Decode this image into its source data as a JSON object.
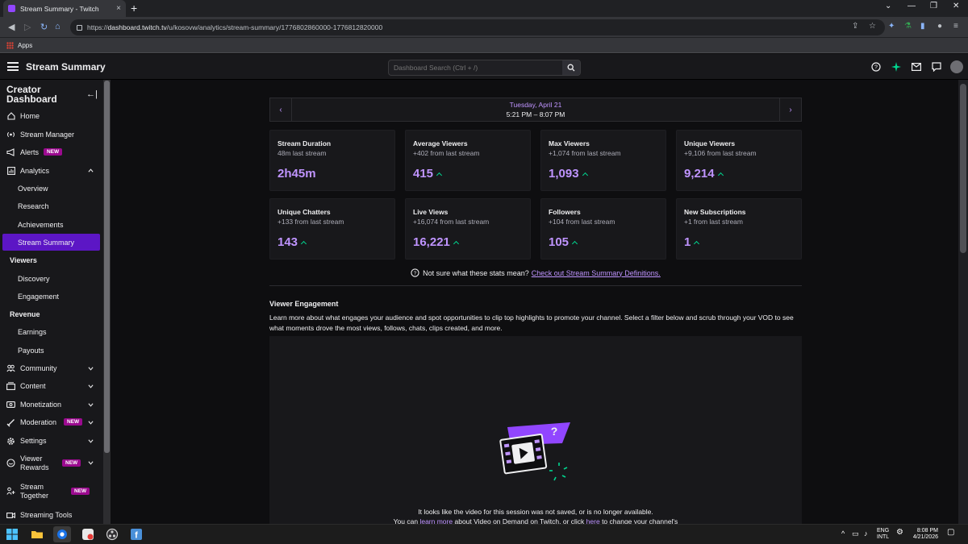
{
  "browser": {
    "tab_title": "Stream Summary - Twitch",
    "tab_close": "×",
    "new_tab": "+",
    "window_controls": [
      "⌄",
      "—",
      "❐",
      "✕"
    ],
    "url_scheme": "https://",
    "url_host": "dashboard.twitch.tv",
    "url_path": "/u/kosovw/analytics/stream-summary/1776802860000-1776812820000",
    "bookmark_apps": "Apps"
  },
  "header": {
    "title": "Stream Summary",
    "search_placeholder": "Dashboard Search (Ctrl + /)"
  },
  "sidebar": {
    "title_line1": "Creator",
    "title_line2": "Dashboard",
    "collapse_glyph": "←|",
    "items": [
      {
        "label": "Home"
      },
      {
        "label": "Stream Manager"
      },
      {
        "label": "Alerts",
        "badge": "NEW"
      },
      {
        "label": "Analytics"
      },
      {
        "label": "Overview"
      },
      {
        "label": "Research"
      },
      {
        "label": "Achievements"
      },
      {
        "label": "Stream Summary"
      },
      {
        "label": "Viewers"
      },
      {
        "label": "Discovery"
      },
      {
        "label": "Engagement"
      },
      {
        "label": "Revenue"
      },
      {
        "label": "Earnings"
      },
      {
        "label": "Payouts"
      },
      {
        "label": "Community"
      },
      {
        "label": "Content"
      },
      {
        "label": "Monetization"
      },
      {
        "label": "Moderation",
        "badge": "NEW"
      },
      {
        "label": "Settings"
      },
      {
        "label": "Viewer",
        "label2": "Rewards",
        "badge": "NEW"
      },
      {
        "label": "Stream",
        "label2": "Together",
        "badge": "NEW"
      },
      {
        "label": "Streaming Tools"
      }
    ]
  },
  "date": {
    "prev": "‹",
    "next": "›",
    "day": "Tuesday, April 21",
    "time": "5:21 PM – 8:07 PM"
  },
  "stats": [
    {
      "title": "Stream Duration",
      "delta": "48m last stream",
      "value": "2h45m",
      "arrow": false
    },
    {
      "title": "Average Viewers",
      "delta": "+402 from last stream",
      "value": "415",
      "arrow": true
    },
    {
      "title": "Max Viewers",
      "delta": "+1,074 from last stream",
      "value": "1,093",
      "arrow": true
    },
    {
      "title": "Unique Viewers",
      "delta": "+9,106 from last stream",
      "value": "9,214",
      "arrow": true
    },
    {
      "title": "Unique Chatters",
      "delta": "+133 from last stream",
      "value": "143",
      "arrow": true
    },
    {
      "title": "Live Views",
      "delta": "+16,074 from last stream",
      "value": "16,221",
      "arrow": true
    },
    {
      "title": "Followers",
      "delta": "+104 from last stream",
      "value": "105",
      "arrow": true
    },
    {
      "title": "New Subscriptions",
      "delta": "+1 from last stream",
      "value": "1",
      "arrow": true
    }
  ],
  "help": {
    "text": "Not sure what these stats mean?",
    "link": "Check out Stream Summary Definitions."
  },
  "engagement": {
    "title": "Viewer Engagement",
    "description": "Learn more about what engages your audience and spot opportunities to clip top highlights to promote your channel. Select a filter below and scrub through your VOD to see what moments drove the most views, follows, chats, clips created, and more.",
    "msg_line1": "It looks like the video for this session was not saved, or is no longer available.",
    "msg_pre": "You can",
    "msg_link1": "learn more",
    "msg_mid": "about Video on Demand on Twitch, or click",
    "msg_link2": "here",
    "msg_post": "to change your channel's"
  },
  "taskbar": {
    "lang1": "ENG",
    "lang2": "INTL",
    "time": "8:08 PM",
    "date": "4/21/2026"
  },
  "colors": {
    "accent": "#9146ff",
    "accent_light": "#bf94ff",
    "active_nav": "#5c16c5",
    "badge": "#9b0a8f",
    "up_arrow": "#00d68f",
    "background": "#0e0e10",
    "card": "#18181b"
  }
}
